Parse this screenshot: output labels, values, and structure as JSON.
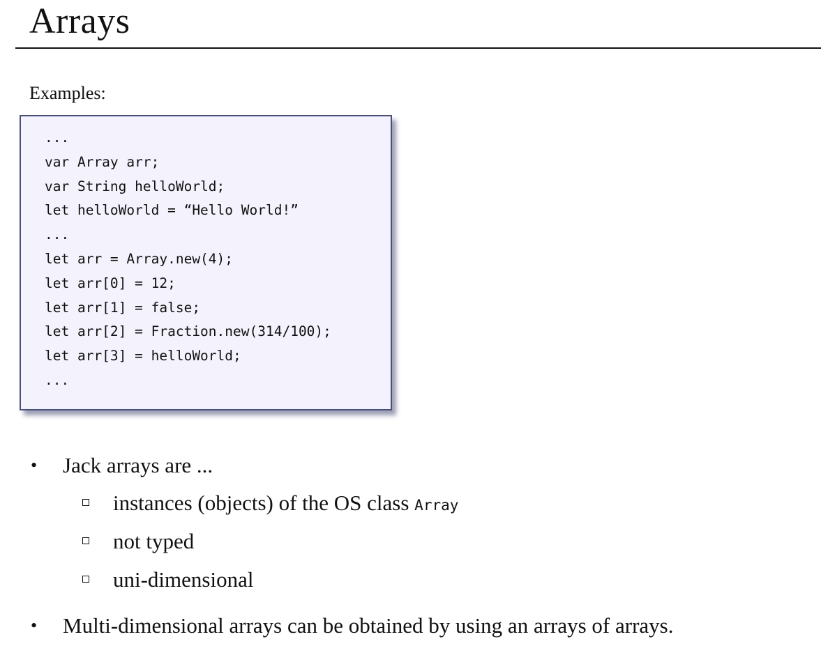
{
  "slide": {
    "title": "Arrays",
    "examples_label": "Examples:"
  },
  "code": {
    "lines": [
      "...",
      "var Array arr;",
      "var String helloWorld;",
      "let helloWorld = “Hello World!”",
      "...",
      "let arr = Array.new(4);",
      "let arr[0] = 12;",
      "let arr[1] = false;",
      "let arr[2] = Fraction.new(314/100);",
      "let arr[3] = helloWorld;",
      "..."
    ]
  },
  "bullets": {
    "first": "Jack arrays are ...",
    "sub_items": {
      "instances_prefix": "instances (objects) of the OS class",
      "instances_code": "Array",
      "not_typed": "not typed",
      "uni_dimensional": "uni-dimensional"
    },
    "second": "Multi-dimensional arrays can be obtained by using an arrays of arrays."
  }
}
